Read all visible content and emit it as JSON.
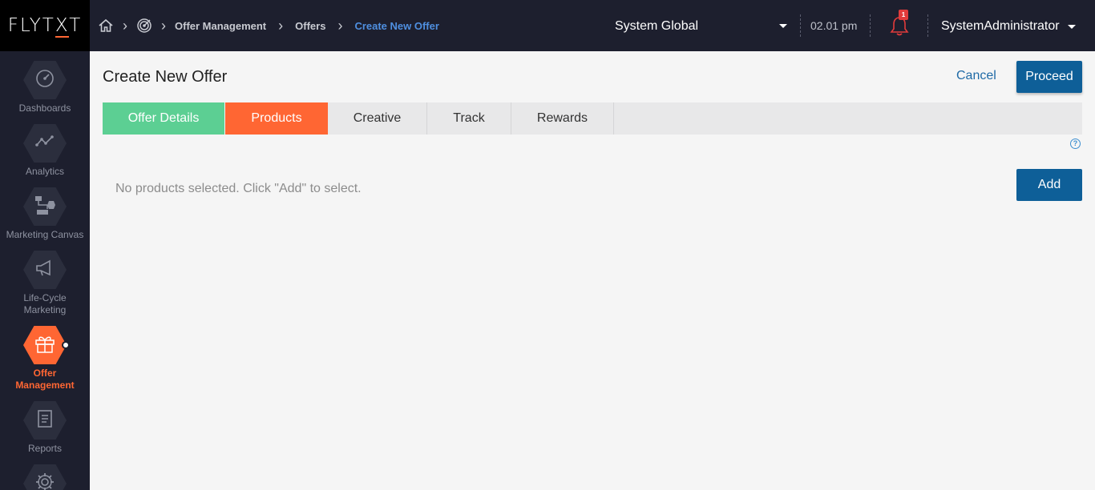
{
  "app": {
    "logo_text_a": "FLYT",
    "logo_text_b": "X",
    "logo_text_c": "T"
  },
  "breadcrumb": {
    "items": [
      "Offer Management",
      "Offers"
    ],
    "current": "Create New Offer"
  },
  "header": {
    "scope": "System Global",
    "time": "02.01 pm",
    "notification_count": "1",
    "user": "SystemAdministrator"
  },
  "sidebar": {
    "items": [
      {
        "label": "Dashboards",
        "icon": "dashboard-gauge-icon"
      },
      {
        "label": "Analytics",
        "icon": "analytics-line-icon"
      },
      {
        "label": "Marketing Canvas",
        "icon": "canvas-flow-icon"
      },
      {
        "label_line1": "Life-Cycle",
        "label_line2": "Marketing",
        "icon": "megaphone-icon"
      },
      {
        "label_line1": "Offer",
        "label_line2": "Management",
        "icon": "gift-icon",
        "active": true
      },
      {
        "label": "Reports",
        "icon": "report-document-icon"
      },
      {
        "label": "",
        "icon": "settings-gear-icon"
      }
    ]
  },
  "page": {
    "title": "Create New Offer",
    "cancel_label": "Cancel",
    "proceed_label": "Proceed"
  },
  "tabs": [
    {
      "label": "Offer Details",
      "state": "done"
    },
    {
      "label": "Products",
      "state": "current"
    },
    {
      "label": "Creative",
      "state": "pending"
    },
    {
      "label": "Track",
      "state": "pending"
    },
    {
      "label": "Rewards",
      "state": "pending"
    }
  ],
  "products": {
    "help_glyph": "?",
    "empty_message": "No products selected. Click \"Add\" to select.",
    "add_label": "Add"
  },
  "colors": {
    "topbar": "#1d1f2e",
    "accent_orange": "#ff6633",
    "done_green": "#5ccf93",
    "primary_blue": "#0e5f98",
    "breadcrumb_current": "#4f8fe0"
  }
}
